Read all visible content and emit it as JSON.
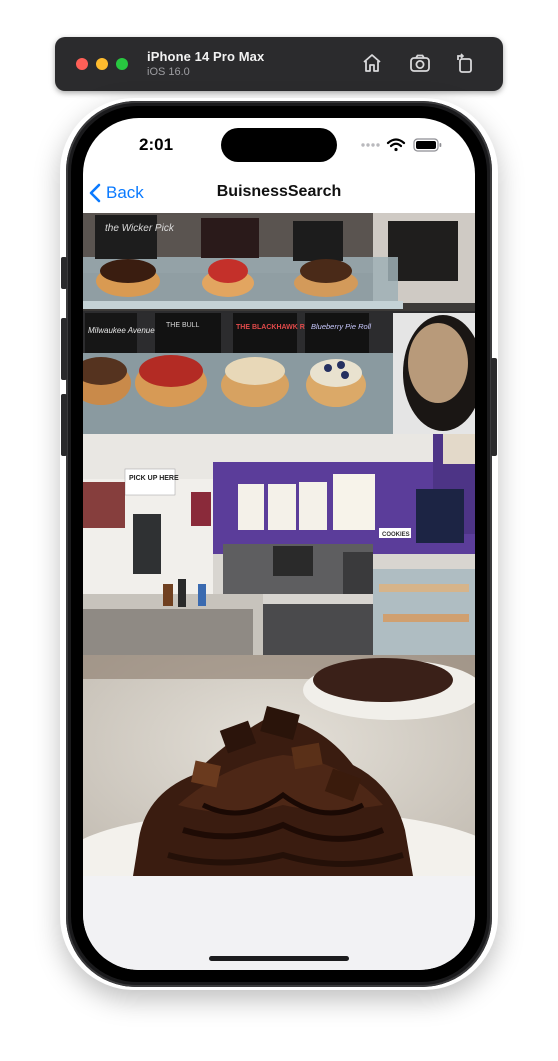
{
  "simulator": {
    "device_name": "iPhone 14 Pro Max",
    "os_version": "iOS 16.0",
    "icons": [
      "home-icon",
      "screenshot-icon",
      "rotate-icon"
    ]
  },
  "status_bar": {
    "time": "2:01"
  },
  "nav": {
    "back_label": "Back",
    "title": "BuisnessSearch"
  },
  "photos": {
    "photo1": {
      "sign_wicker": "the Wicker Pick",
      "sign_milwaukee": "Milwaukee Avenue",
      "sign_bull": "THE BULL",
      "sign_blackhawk": "THE BLACKHAWK ROLL",
      "sign_blueberry": "Blueberry Pie Roll"
    },
    "photo2": {
      "sign_pickup": "PICK UP HERE",
      "sign_cookies": "COOKIES"
    },
    "photo3": {}
  },
  "colors": {
    "accent": "#0a7aff",
    "toolbar": "#2b2b2d",
    "storefront_purple": "#5b3d9a"
  }
}
